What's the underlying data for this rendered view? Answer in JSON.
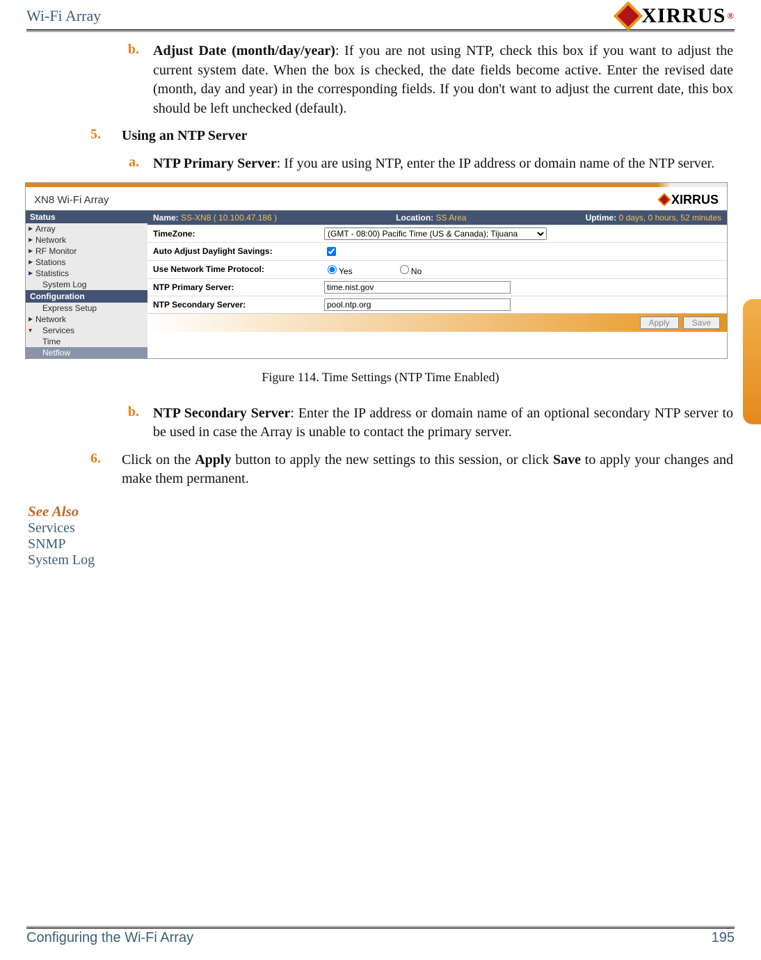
{
  "header": {
    "title": "Wi-Fi Array",
    "logo_text": "XIRRUS",
    "logo_tm": "®"
  },
  "items": {
    "b_adjust": {
      "marker": "b.",
      "bold": "Adjust Date (month/day/year)",
      "text": ": If you are not using NTP, check this box if you want to adjust the current system date. When the box is checked, the date fields become active. Enter the revised date (month, day and year) in the corresponding fields. If you don't want to adjust the current date, this box should be left unchecked (default)."
    },
    "step5": {
      "marker": "5.",
      "bold": "Using an NTP Server"
    },
    "a_primary": {
      "marker": "a.",
      "bold": "NTP Primary Server",
      "text": ": If you are using NTP, enter the IP address or domain name of the NTP server."
    },
    "b_secondary": {
      "marker": "b.",
      "bold": "NTP Secondary Server",
      "text": ": Enter the IP address or domain name of an optional secondary NTP server to be used in case the Array is unable to contact the primary server."
    },
    "step6": {
      "marker": "6.",
      "pre": "Click on the ",
      "bold1": "Apply",
      "mid": " button to apply the new settings to this session, or click ",
      "bold2": "Save",
      "post": " to apply your changes and make them permanent."
    }
  },
  "screenshot": {
    "title": "XN8 Wi-Fi Array",
    "logo": "XIRRUS",
    "nav": {
      "status": "Status",
      "array": "Array",
      "network": "Network",
      "rf": "RF Monitor",
      "stations": "Stations",
      "statistics": "Statistics",
      "syslog": "System Log",
      "config": "Configuration",
      "express": "Express Setup",
      "network2": "Network",
      "services": "Services",
      "time": "Time",
      "netflow": "Netflow"
    },
    "info": {
      "name_lbl": "Name:",
      "name_val": "SS-XN8   ( 10.100.47.186 )",
      "loc_lbl": "Location:",
      "loc_val": "SS Area",
      "up_lbl": "Uptime:",
      "up_val": "0 days, 0 hours, 52 minutes"
    },
    "form": {
      "tz_lbl": "TimeZone:",
      "tz_val": "(GMT - 08:00) Pacific Time (US & Canada); Tijuana",
      "dst_lbl": "Auto Adjust Daylight Savings:",
      "ntp_lbl": "Use Network Time Protocol:",
      "yes": "Yes",
      "no": "No",
      "prim_lbl": "NTP Primary Server:",
      "prim_val": "time.nist.gov",
      "sec_lbl": "NTP Secondary Server:",
      "sec_val": "pool.ntp.org",
      "apply": "Apply",
      "save": "Save"
    }
  },
  "fig_caption": "Figure 114. Time Settings (NTP Time Enabled)",
  "see_also": {
    "title": "See Also",
    "links": [
      "Services",
      "SNMP",
      "System Log"
    ]
  },
  "footer": {
    "left": "Configuring the Wi-Fi Array",
    "right": "195"
  }
}
